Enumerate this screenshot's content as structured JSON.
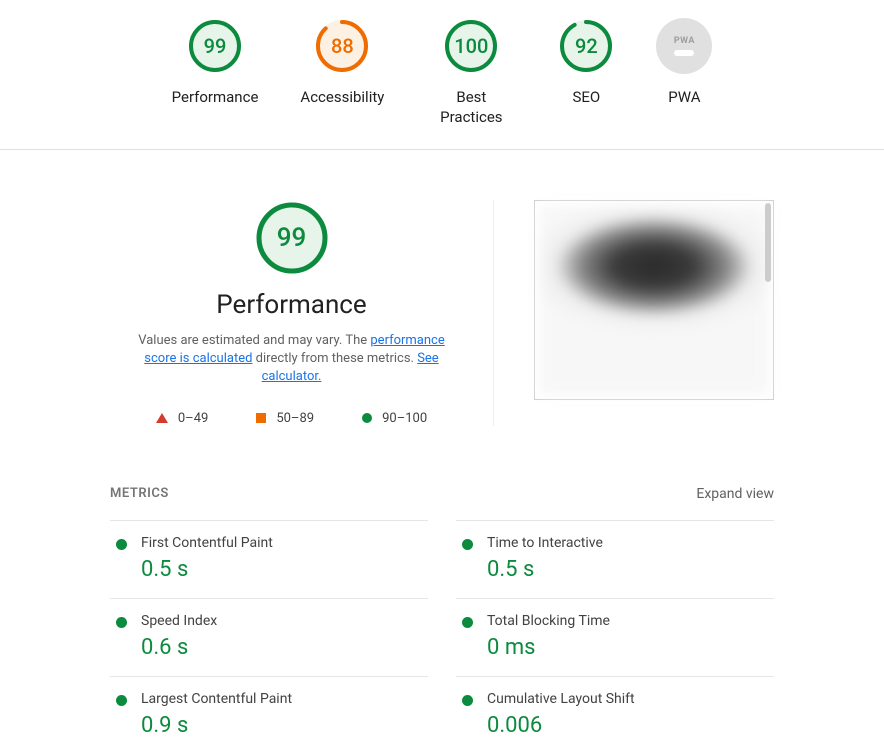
{
  "colors": {
    "green": "#0c8a3e",
    "green_fill": "#e6f4ea",
    "orange": "#ef6c00",
    "orange_fill": "#fdf1e4",
    "grey": "#e0e0e0"
  },
  "gauges": [
    {
      "id": "performance",
      "label": "Performance",
      "score": "99",
      "pct": 99,
      "status": "green"
    },
    {
      "id": "accessibility",
      "label": "Accessibility",
      "score": "88",
      "pct": 88,
      "status": "orange"
    },
    {
      "id": "best-practices",
      "label": "Best Practices",
      "score": "100",
      "pct": 100,
      "status": "green"
    },
    {
      "id": "seo",
      "label": "SEO",
      "score": "92",
      "pct": 92,
      "status": "green"
    },
    {
      "id": "pwa",
      "label": "PWA",
      "kind": "pwa"
    }
  ],
  "perf": {
    "score": "99",
    "pct": 99,
    "title": "Performance",
    "desc_pre": "Values are estimated and may vary. The ",
    "desc_link1": "performance score is calculated",
    "desc_mid": " directly from these metrics. ",
    "desc_link2": "See calculator."
  },
  "legend": [
    {
      "shape": "triangle",
      "label": "0–49"
    },
    {
      "shape": "square",
      "label": "50–89"
    },
    {
      "shape": "circle",
      "label": "90–100"
    }
  ],
  "metrics_header": "METRICS",
  "expand_label": "Expand view",
  "metrics": [
    {
      "name": "First Contentful Paint",
      "value": "0.5 s"
    },
    {
      "name": "Time to Interactive",
      "value": "0.5 s"
    },
    {
      "name": "Speed Index",
      "value": "0.6 s"
    },
    {
      "name": "Total Blocking Time",
      "value": "0 ms"
    },
    {
      "name": "Largest Contentful Paint",
      "value": "0.9 s"
    },
    {
      "name": "Cumulative Layout Shift",
      "value": "0.006"
    }
  ]
}
